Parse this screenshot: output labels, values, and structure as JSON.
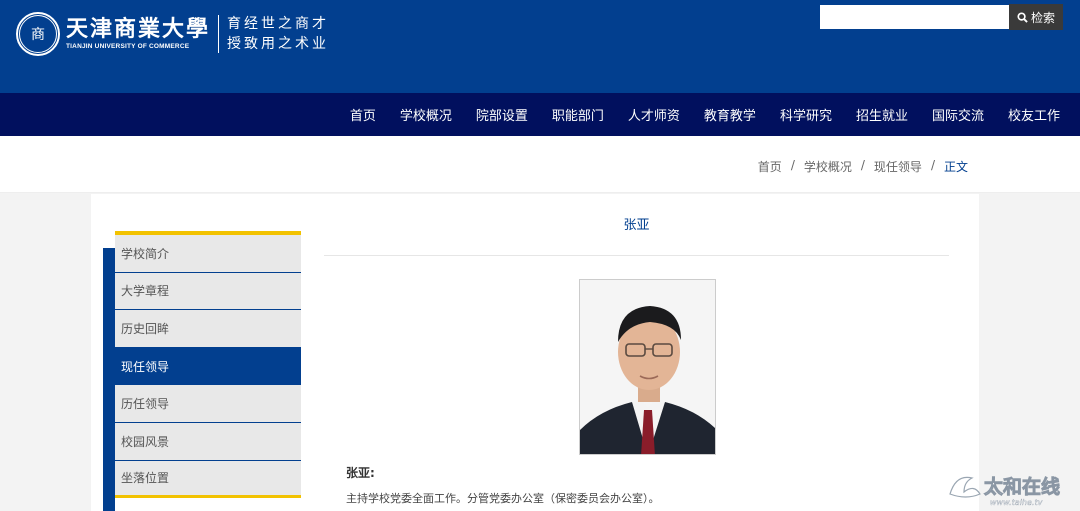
{
  "header": {
    "logo_seal": "商",
    "logo_cn": "天津商業大學",
    "logo_en": "TIANJIN UNIVERSITY OF COMMERCE",
    "motto_line1": "育经世之商才",
    "motto_line2": "授致用之术业",
    "search": {
      "value": "",
      "placeholder": "",
      "button_label": "检索"
    },
    "color": "#023f8f"
  },
  "nav": {
    "items": [
      "首页",
      "学校概况",
      "院部设置",
      "职能部门",
      "人才师资",
      "教育教学",
      "科学研究",
      "招生就业",
      "国际交流",
      "校友工作"
    ],
    "color": "#01105e"
  },
  "breadcrumb": {
    "items": [
      "首页",
      "学校概况",
      "现任领导"
    ],
    "separator": "/",
    "current": "正文"
  },
  "sidebar": {
    "items": [
      "学校简介",
      "大学章程",
      "历史回眸",
      "现任领导",
      "历任领导",
      "校园风景",
      "坐落位置"
    ],
    "active_index": 3,
    "accent": "#f2c200"
  },
  "article": {
    "title": "张亚",
    "name_label": "张亚:",
    "description": "主持学校党委全面工作。分管党委办公室（保密委员会办公室）。"
  },
  "watermark": {
    "text": "太和在线",
    "url_text": "www.taihe.tv"
  }
}
